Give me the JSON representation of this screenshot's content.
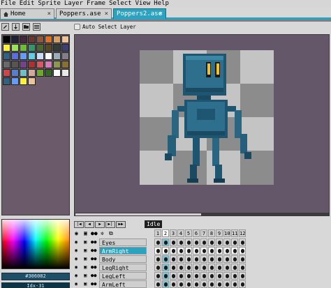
{
  "menu": [
    "File",
    "Edit",
    "Sprite",
    "Layer",
    "Frame",
    "Select",
    "View",
    "Help"
  ],
  "tabs": [
    {
      "label": "Home",
      "close": "×",
      "active": false
    },
    {
      "label": "Poppers.ase",
      "close": "×",
      "active": false
    },
    {
      "label": "Poppers2.ase",
      "close": "×",
      "active": true
    }
  ],
  "context_bar": {
    "tools": [
      "pencil-icon",
      "arrow-down-icon",
      "folder-icon",
      "list-icon"
    ],
    "auto_select_label": "Auto Select Layer",
    "auto_select_checked": false
  },
  "palette": {
    "colors": [
      "#000000",
      "#222034",
      "#45283c",
      "#663931",
      "#8f563b",
      "#df7126",
      "#d9a066",
      "#eec39a",
      "#fbf236",
      "#99e550",
      "#6abe30",
      "#37946e",
      "#4b692f",
      "#524b24",
      "#323c39",
      "#3f3f74",
      "#306082",
      "#5b6ee1",
      "#639bff",
      "#5fcde4",
      "#cbdbfc",
      "#ffffff",
      "#9badb7",
      "#847e87",
      "#696a6a",
      "#595652",
      "#76428a",
      "#ac3232",
      "#d95763",
      "#d77bba",
      "#8f974a",
      "#8a6f30",
      "#d04648",
      "#597dce",
      "#6dc2ca",
      "#d2aa99",
      "#6daa2c",
      "#346524",
      "#ffffff",
      "#e8e8e8",
      "#306082",
      "#639bff",
      "#fbf236",
      "#eec39a"
    ]
  },
  "color_panel": {
    "foreground_hex": "#306082",
    "index_label": "Idx-31"
  },
  "timeline": {
    "tag": "Idle",
    "controls": [
      "first-frame",
      "prev-frame",
      "play",
      "next-frame",
      "last-frame"
    ],
    "frames": [
      "1",
      "2",
      "3",
      "4",
      "5",
      "6",
      "7",
      "8",
      "9",
      "10",
      "11",
      "12"
    ],
    "active_frame": 2,
    "layers": [
      {
        "name": "Eyes",
        "active": false
      },
      {
        "name": "ArmRight",
        "active": true
      },
      {
        "name": "Body",
        "active": false
      },
      {
        "name": "LegRight",
        "active": false
      },
      {
        "name": "LegLeft",
        "active": false
      },
      {
        "name": "ArmLeft",
        "active": false
      }
    ]
  },
  "colors": {
    "accent": "#2ba2bf",
    "workspace_bg": "#645769",
    "robot_body": "#2d5f7a"
  }
}
